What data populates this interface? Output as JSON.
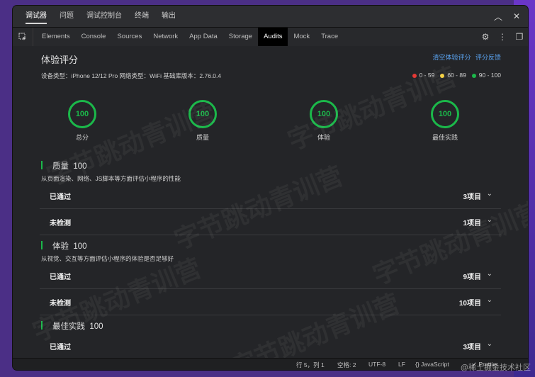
{
  "top_tabs": [
    {
      "label": "调试器"
    },
    {
      "label": "问题"
    },
    {
      "label": "调试控制台"
    },
    {
      "label": "终端"
    },
    {
      "label": "输出"
    }
  ],
  "panel_tabs": [
    {
      "label": "Elements"
    },
    {
      "label": "Console"
    },
    {
      "label": "Sources"
    },
    {
      "label": "Network"
    },
    {
      "label": "App Data"
    },
    {
      "label": "Storage"
    },
    {
      "label": "Audits"
    },
    {
      "label": "Mock"
    },
    {
      "label": "Trace"
    }
  ],
  "audits": {
    "title": "体验评分",
    "clear_link": "清空体验评分",
    "feedback_link": "评分反馈",
    "device_info": "设备类型：iPhone 12/12 Pro  网络类型：WiFi  基础库版本：2.76.0.4",
    "legend": [
      {
        "color": "#e53935",
        "text": "0 - 59"
      },
      {
        "color": "#f4d03f",
        "text": "60 - 89"
      },
      {
        "color": "#1bb84a",
        "text": "90 - 100"
      }
    ],
    "gauges": [
      {
        "score": "100",
        "label": "总分"
      },
      {
        "score": "100",
        "label": "质量"
      },
      {
        "score": "100",
        "label": "体验"
      },
      {
        "score": "100",
        "label": "最佳实践"
      }
    ],
    "sections": [
      {
        "name": "质量",
        "score": "100",
        "description": "从页面渲染、网络、JS脚本等方面评估小程序的性能",
        "rows": [
          {
            "label": "已通过",
            "count": "3项目"
          },
          {
            "label": "未检测",
            "count": "1项目"
          }
        ]
      },
      {
        "name": "体验",
        "score": "100",
        "description": "从视觉、交互等方面评估小程序的体验是否足够好",
        "rows": [
          {
            "label": "已通过",
            "count": "9项目"
          },
          {
            "label": "未检测",
            "count": "10项目"
          }
        ]
      },
      {
        "name": "最佳实践",
        "score": "100",
        "description": "",
        "rows": [
          {
            "label": "已通过",
            "count": "3项目"
          }
        ]
      }
    ]
  },
  "status_bar": {
    "position": "行 5，列 1",
    "spaces": "空格: 2",
    "encoding": "UTF-8",
    "eol": "LF",
    "language": "{} JavaScript",
    "prettier": "✓ Prettier"
  },
  "watermarks": [
    "字节跳动青训营",
    "字节跳动青训营",
    "字节跳动青训营",
    "字节跳动青训营",
    "字节跳动青训营",
    "字节跳动青训营"
  ],
  "corner_watermark": "@稀土掘金技术社区",
  "icons": {
    "inspect": "inspect-element-icon",
    "settings": "gear-icon",
    "more": "more-vertical-icon",
    "dock": "dock-icon",
    "collapse": "chevron-up-icon",
    "close": "close-icon",
    "row_toggle": "chevron-down-icon"
  }
}
